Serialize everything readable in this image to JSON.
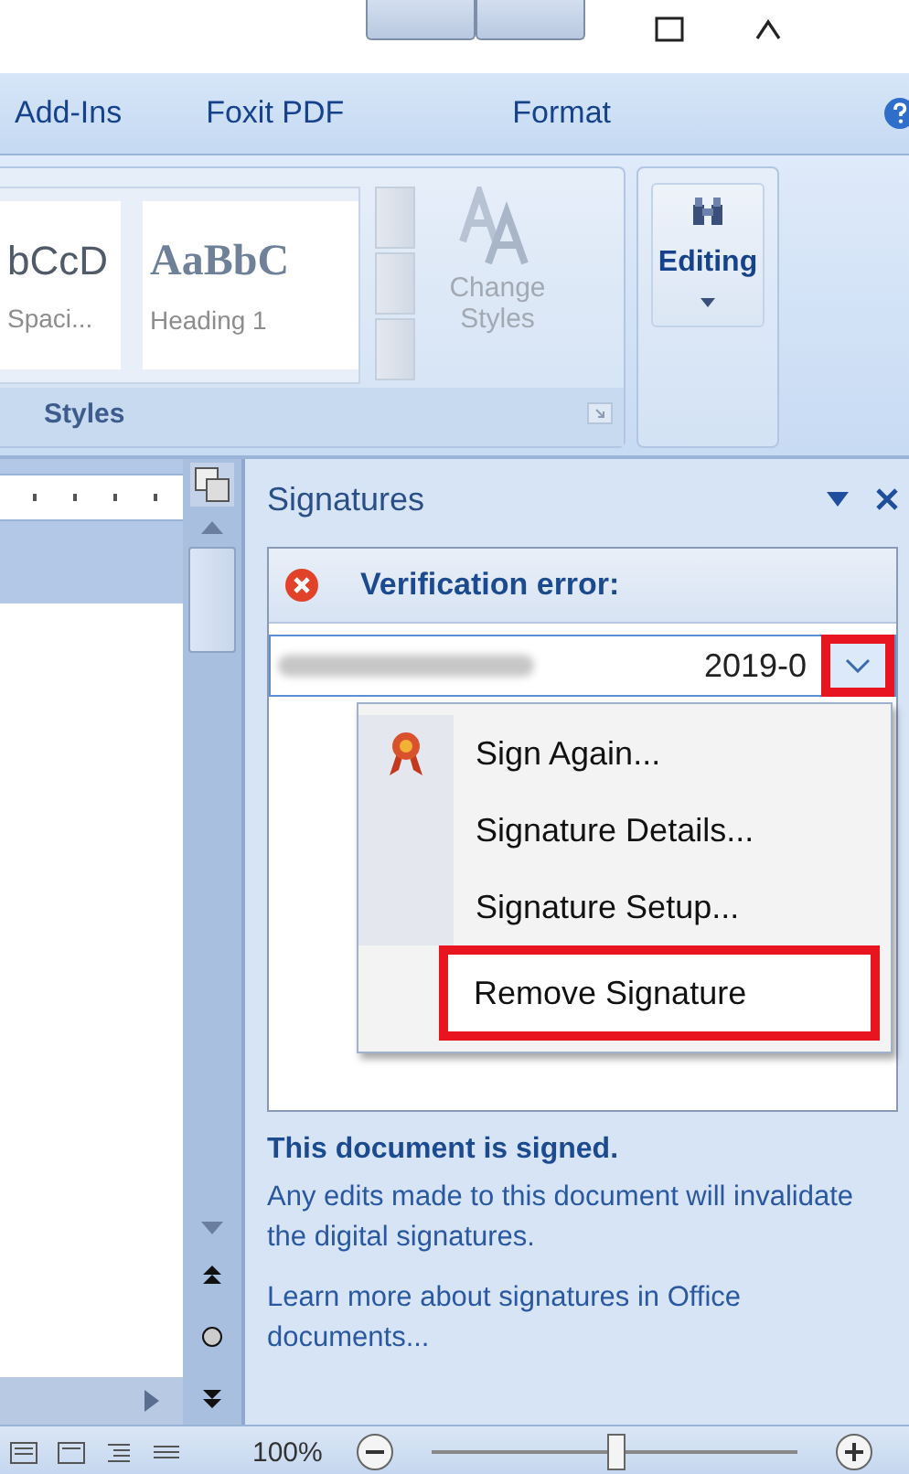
{
  "ribbon_tabs": [
    {
      "label": "Add-Ins",
      "selected": false
    },
    {
      "label": "Foxit PDF",
      "selected": false
    },
    {
      "label": "Format",
      "selected": false
    }
  ],
  "styles_group": {
    "label": "Styles",
    "gallery": [
      {
        "sample": "bCcD",
        "name": "Spaci...",
        "kind": "plain"
      },
      {
        "sample": "AaBbC",
        "name": "Heading 1",
        "kind": "heading"
      }
    ],
    "change_styles": "Change Styles"
  },
  "editing_group": {
    "label": "Editing"
  },
  "task_pane": {
    "title": "Signatures",
    "status_heading": "Verification error:",
    "signature": {
      "date": "2019-0",
      "highlighted": true
    },
    "menu": [
      {
        "label": "Sign Again...",
        "icon": true,
        "highlighted": false
      },
      {
        "label": "Signature Details...",
        "icon": false,
        "highlighted": false
      },
      {
        "label": "Signature Setup...",
        "icon": false,
        "highlighted": false
      },
      {
        "label": "Remove Signature",
        "icon": false,
        "highlighted": true
      }
    ],
    "signed_heading": "This document is signed.",
    "signed_note": "Any edits made to this document will invalidate the digital signatures.",
    "learn_more_link": "Learn more about signatures in Office documents..."
  },
  "status_bar": {
    "zoom": "100%",
    "zoom_slider": {
      "level": 0.5
    }
  }
}
